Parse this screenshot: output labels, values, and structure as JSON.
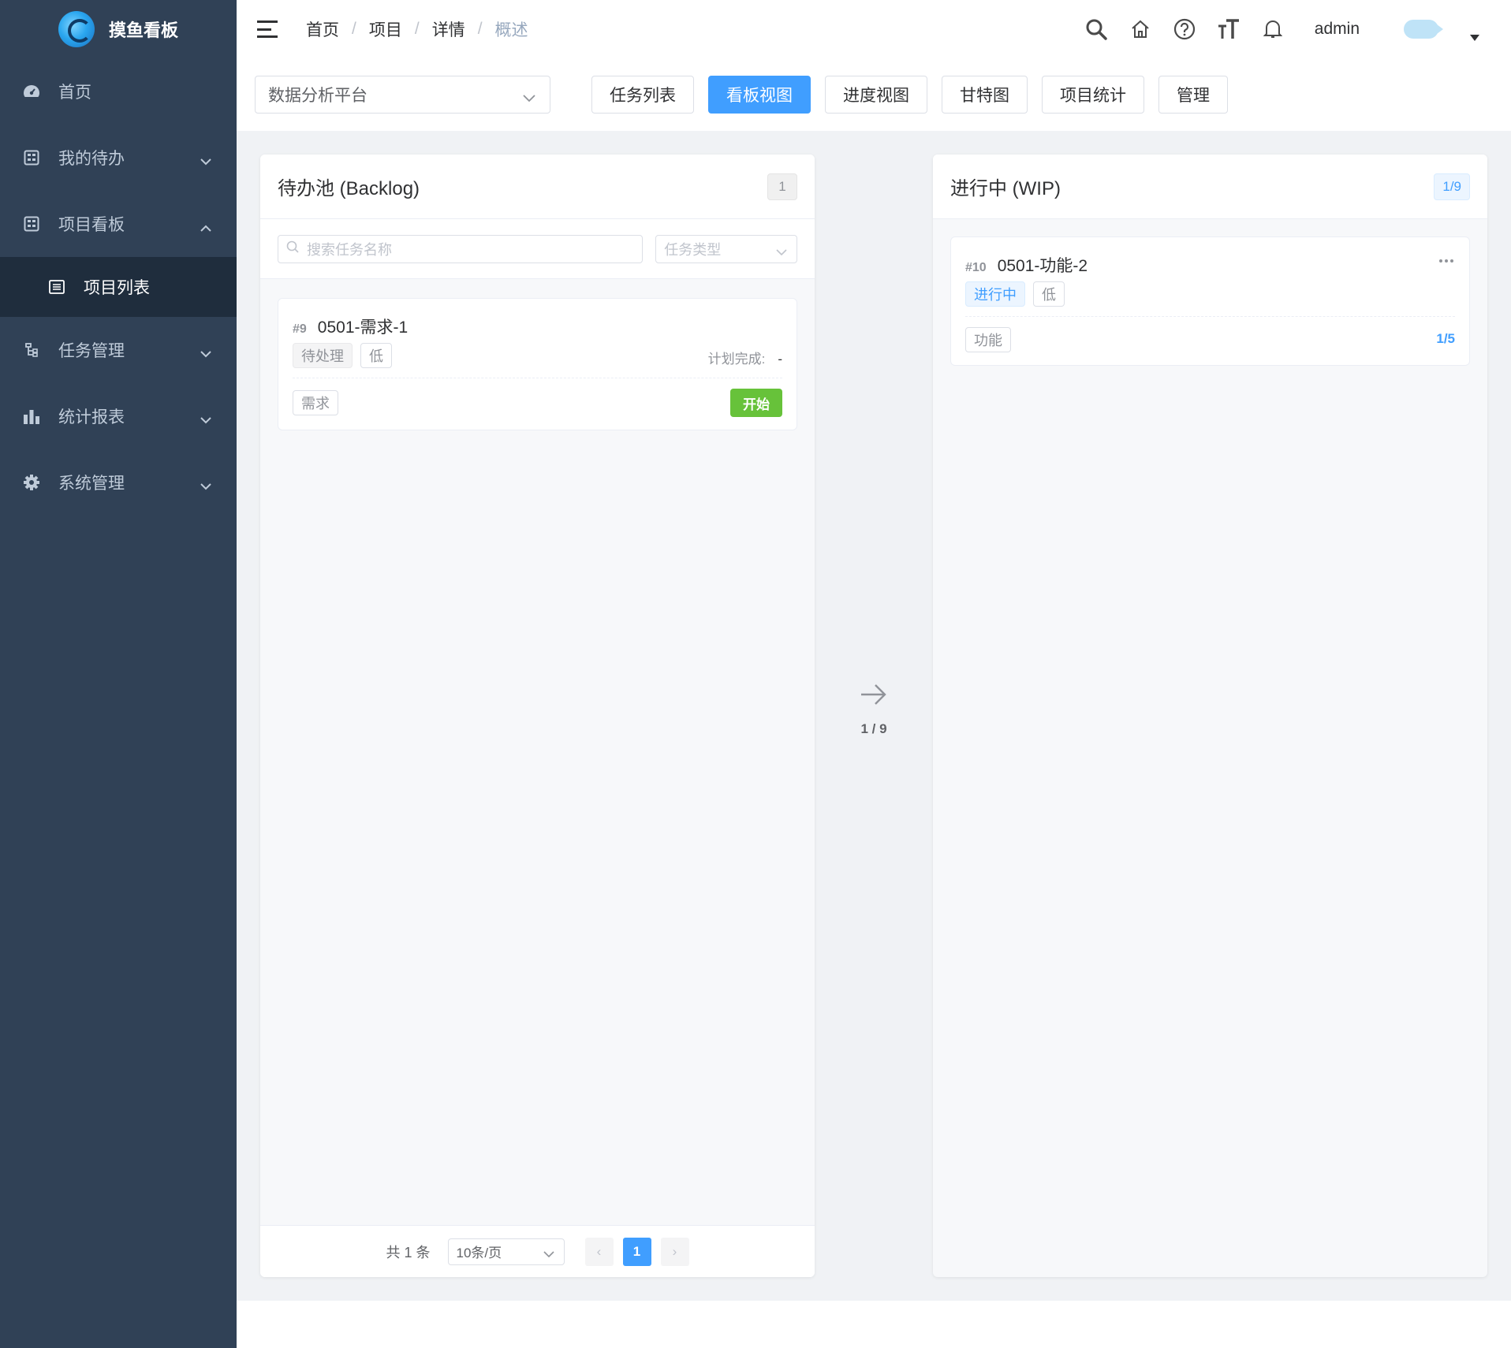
{
  "app": {
    "title": "摸鱼看板"
  },
  "sidebar": {
    "items": [
      {
        "label": "首页",
        "icon": "dashboard-icon"
      },
      {
        "label": "我的待办",
        "icon": "todo-icon"
      },
      {
        "label": "项目看板",
        "icon": "board-icon",
        "expanded": true,
        "children": [
          {
            "label": "项目列表",
            "icon": "list-icon"
          }
        ]
      },
      {
        "label": "任务管理",
        "icon": "tree-icon"
      },
      {
        "label": "统计报表",
        "icon": "bar-chart-icon"
      },
      {
        "label": "系统管理",
        "icon": "gear-icon"
      }
    ]
  },
  "header": {
    "breadcrumb": [
      "首页",
      "项目",
      "详情",
      "概述"
    ],
    "username": "admin"
  },
  "toolbar": {
    "project": "数据分析平台",
    "tabs": [
      "任务列表",
      "看板视图",
      "进度视图",
      "甘特图",
      "项目统计",
      "管理"
    ],
    "active_tab": "看板视图"
  },
  "backlog": {
    "title": "待办池 (Backlog)",
    "count": "1",
    "search_placeholder": "搜索任务名称",
    "type_placeholder": "任务类型",
    "card": {
      "id": "#9",
      "name": "0501-需求-1",
      "status": "待处理",
      "priority": "低",
      "plan_label": "计划完成:",
      "plan_value": "-",
      "type": "需求",
      "action": "开始"
    },
    "pager": {
      "total": "共 1 条",
      "page_size": "10条/页",
      "page": "1",
      "prev": "‹",
      "next": "›"
    }
  },
  "flow": {
    "label": "1 / 9"
  },
  "wip": {
    "title": "进行中 (WIP)",
    "count": "1/9",
    "card": {
      "id": "#10",
      "name": "0501-功能-2",
      "status": "进行中",
      "priority": "低",
      "type": "功能",
      "progress": "1/5"
    }
  },
  "colors": {
    "sidebar": "#304156",
    "accent": "#409eff",
    "success": "#67c23a"
  }
}
